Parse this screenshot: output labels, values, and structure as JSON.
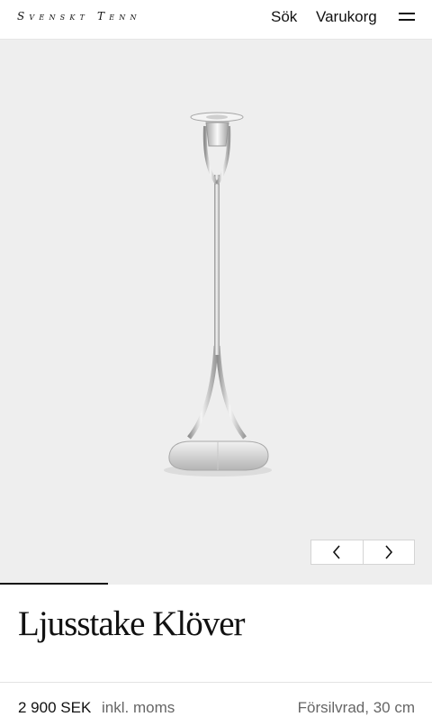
{
  "header": {
    "logo": "Svenskt Tenn",
    "search_label": "Sök",
    "cart_label": "Varukorg",
    "menu_icon": "hamburger-menu-icon"
  },
  "gallery": {
    "background": "#eeeeee",
    "image_subject": "candlestick",
    "prev_icon": "chevron-left-icon",
    "next_icon": "chevron-right-icon",
    "progress": 0.25
  },
  "product": {
    "title": "Ljusstake Klöver",
    "price": "2 900 SEK",
    "vat_note": "inkl. moms",
    "spec": "Försilvrad, 30 cm"
  }
}
